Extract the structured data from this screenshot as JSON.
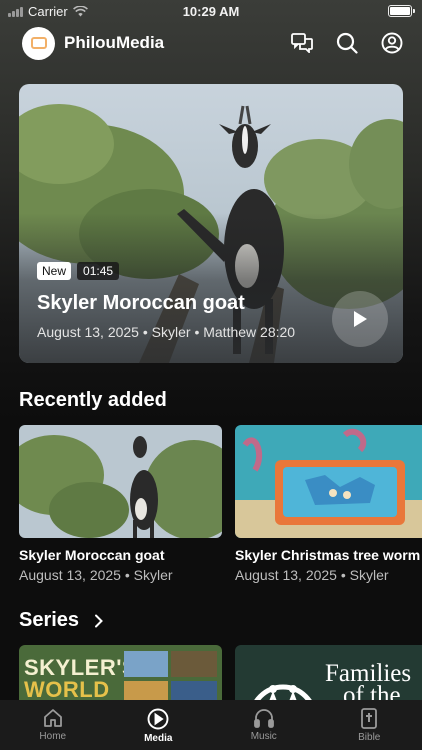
{
  "status_bar": {
    "carrier": "Carrier",
    "time": "10:29 AM"
  },
  "header": {
    "brand": "PhilouMedia",
    "icons": [
      "chat-icon",
      "search-icon",
      "account-icon"
    ]
  },
  "hero": {
    "badge": "New",
    "duration": "01:45",
    "title": "Skyler Moroccan goat",
    "meta": "August 13, 2025 • Skyler • Matthew 28:20"
  },
  "recently_added": {
    "title": "Recently added",
    "items": [
      {
        "title": "Skyler Moroccan goat",
        "meta": "August 13, 2025 • Skyler"
      },
      {
        "title": "Skyler Christmas tree worm",
        "meta": "August 13, 2025 • Skyler"
      }
    ]
  },
  "series": {
    "title": "Series",
    "items": [
      {
        "art_text_1": "SKYLER'S",
        "art_text_2": "WORLD"
      },
      {
        "art_text_1": "Families",
        "art_text_2": "of the"
      }
    ]
  },
  "tabs": [
    {
      "label": "Home",
      "icon": "home-icon",
      "active": false
    },
    {
      "label": "Media",
      "icon": "play-circle-icon",
      "active": true
    },
    {
      "label": "Music",
      "icon": "headphones-icon",
      "active": false
    },
    {
      "label": "Bible",
      "icon": "bible-icon",
      "active": false
    }
  ],
  "colors": {
    "background": "#0d0d0d",
    "tabbar": "#1b1b1b",
    "accent": "#ffffff",
    "muted": "#9a9a9a"
  }
}
